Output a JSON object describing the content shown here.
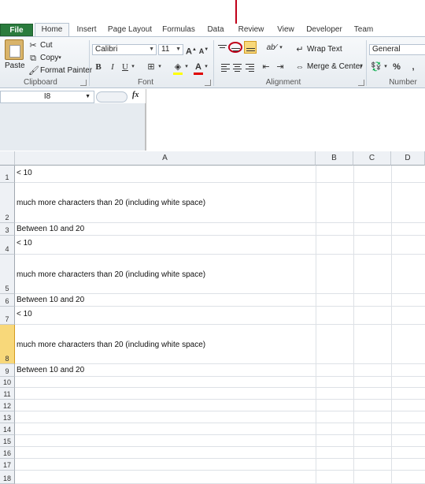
{
  "tabs": [
    "File",
    "Home",
    "Insert",
    "Page Layout",
    "Formulas",
    "Data",
    "Review",
    "View",
    "Developer",
    "Team"
  ],
  "clipboard": {
    "paste": "Paste",
    "cut": "Cut",
    "copy": "Copy",
    "format_painter": "Format Painter",
    "label": "Clipboard"
  },
  "font": {
    "name": "Calibri",
    "size": "11",
    "label": "Font"
  },
  "alignment": {
    "wrap_text": "Wrap Text",
    "merge_center": "Merge & Center",
    "label": "Alignment"
  },
  "number": {
    "format": "General",
    "label": "Number",
    "percent": "%"
  },
  "formula_bar": {
    "name_box": "I8",
    "fx": "fx"
  },
  "columns": [
    "A",
    "B",
    "C",
    "D"
  ],
  "rows": [
    {
      "num": "1",
      "a": "< 10"
    },
    {
      "num": "2",
      "a": "much more characters than 20 (including white space)"
    },
    {
      "num": "3",
      "a": "Between 10 and 20"
    },
    {
      "num": "4",
      "a": "< 10"
    },
    {
      "num": "5",
      "a": "much more characters than 20 (including white space)"
    },
    {
      "num": "6",
      "a": "Between 10 and 20"
    },
    {
      "num": "7",
      "a": "< 10"
    },
    {
      "num": "8",
      "a": "much more characters than 20 (including white space)"
    },
    {
      "num": "9",
      "a": "Between 10 and 20"
    },
    {
      "num": "10",
      "a": ""
    },
    {
      "num": "11",
      "a": ""
    },
    {
      "num": "12",
      "a": ""
    },
    {
      "num": "13",
      "a": ""
    },
    {
      "num": "14",
      "a": ""
    },
    {
      "num": "15",
      "a": ""
    },
    {
      "num": "16",
      "a": ""
    },
    {
      "num": "17",
      "a": ""
    },
    {
      "num": "18",
      "a": ""
    }
  ],
  "selected_row": "8",
  "annotation_color": "#c0001a",
  "accent_green": "#2a7b3d",
  "highlight_yellow": "#f8d87a"
}
